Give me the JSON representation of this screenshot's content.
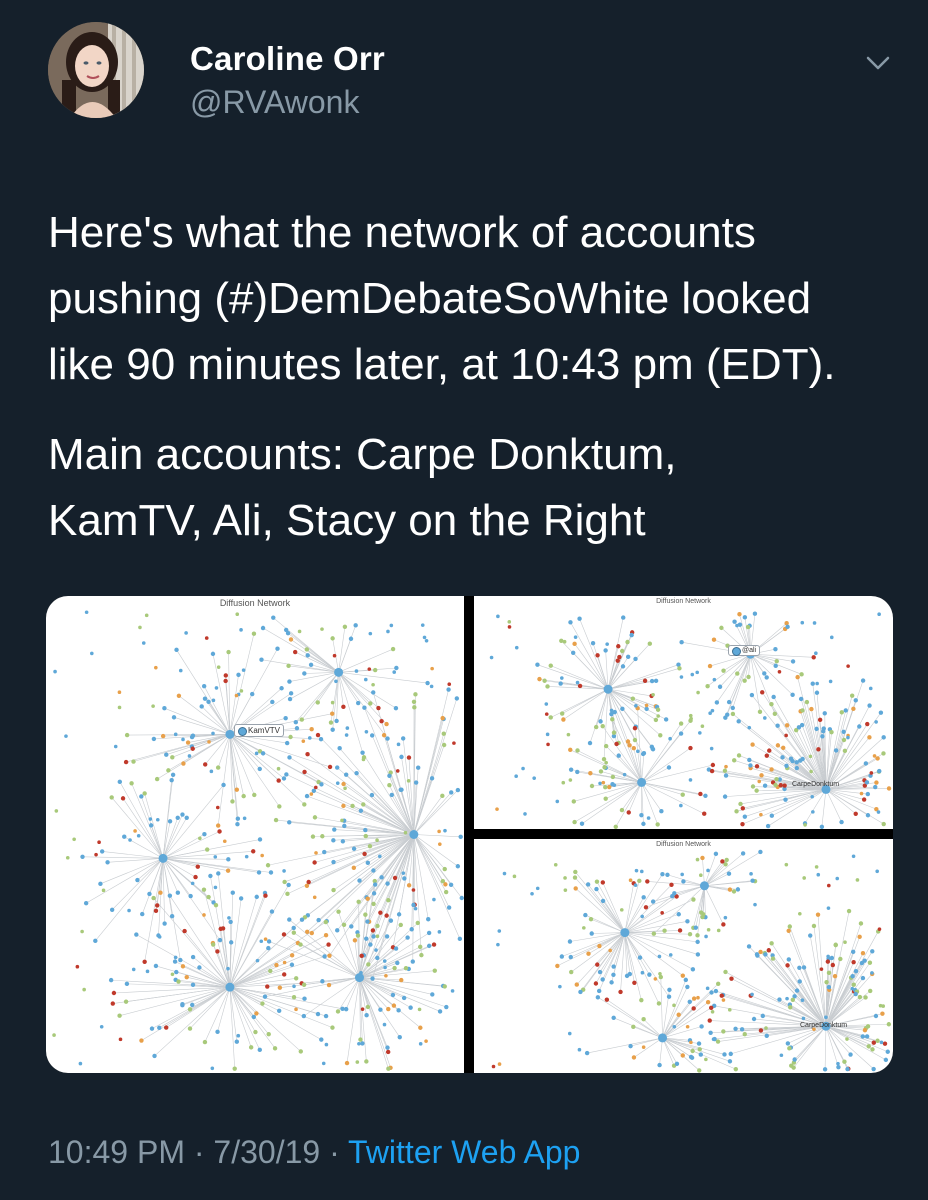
{
  "author": {
    "name": "Caroline Orr",
    "handle": "@RVAwonk",
    "avatar_icon": "profile-photo"
  },
  "tweet": {
    "paragraphs": [
      "Here's what the network of accounts\npushing (#)DemDebateSoWhite looked\nlike 90 minutes later, at 10:43 pm (EDT).",
      "Main accounts: Carpe Donktum,\nKamTV, Ali, Stacy on the Right"
    ]
  },
  "media": {
    "left": {
      "title": "Diffusion Network",
      "labels": [
        "KamVTV"
      ]
    },
    "top_right": {
      "title": "Diffusion Network",
      "labels": [
        "@ali",
        "CarpeDonktum"
      ]
    },
    "bottom_right": {
      "title": "Diffusion Network",
      "labels": [
        "CarpeDonktum"
      ]
    }
  },
  "footer": {
    "time": "10:49 PM",
    "separator": "·",
    "date": "7/30/19",
    "source": "Twitter Web App"
  },
  "colors": {
    "background": "#15202b",
    "secondary_text": "#8899a6",
    "link": "#1da1f2",
    "node_blue": "#5fa8d8",
    "node_green": "#a8c97a",
    "node_orange": "#e8a04a",
    "node_red": "#c0392b",
    "edge": "#c8ccd0"
  }
}
